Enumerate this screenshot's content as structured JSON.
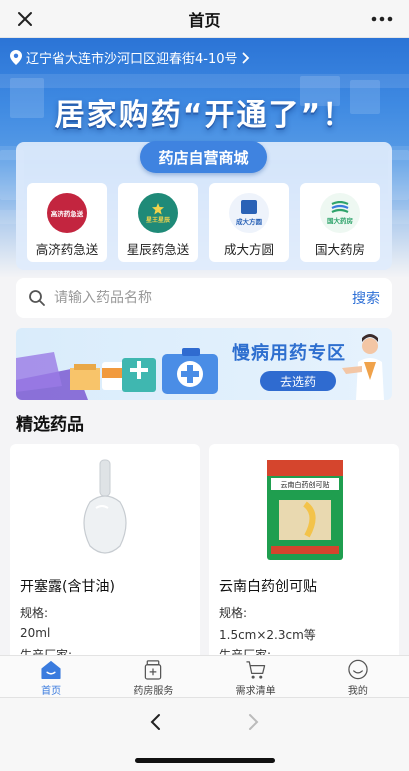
{
  "topbar": {
    "title": "首页",
    "close_icon": "close-icon",
    "more_icon": "more-icon"
  },
  "banner": {
    "location": "辽宁省大连市沙河口区迎春街4-10号",
    "slogan": "居家购药“开通了”！",
    "store_tag": "药店自营商城",
    "stores": [
      {
        "name": "高济药急送",
        "logo_text": "高济药急送",
        "logo_color": "#c3253f"
      },
      {
        "name": "星辰药急送",
        "logo_text": "星王星辰",
        "logo_color": "#1f8a78"
      },
      {
        "name": "成大方圆",
        "logo_text": "成大方圆",
        "logo_color": "#2a62b6"
      },
      {
        "name": "国大药房",
        "logo_text": "国大药房",
        "logo_color": "#2fa36b"
      }
    ]
  },
  "search": {
    "placeholder": "请输入药品名称",
    "button": "搜索"
  },
  "promo": {
    "title": "慢病用药专区",
    "button": "去选药"
  },
  "section": {
    "title": "精选药品"
  },
  "products": [
    {
      "name": "开塞露(含甘油)",
      "spec_label": "规格:",
      "spec": "20ml",
      "maker_label": "生产厂家:"
    },
    {
      "name": "云南白药创可贴",
      "spec_label": "规格:",
      "spec": "1.5cm×2.3cm等",
      "maker_label": "生产厂家:",
      "box_text": "云南白药创可贴"
    }
  ],
  "tabs": [
    {
      "label": "首页",
      "icon": "home-icon",
      "active": true
    },
    {
      "label": "药房服务",
      "icon": "pharmacy-icon",
      "active": false
    },
    {
      "label": "需求清单",
      "icon": "cart-icon",
      "active": false
    },
    {
      "label": "我的",
      "icon": "profile-icon",
      "active": false
    }
  ],
  "colors": {
    "accent": "#3a7bde",
    "banner_blue": "#3f83e0",
    "promo_title": "#2e6fcf"
  }
}
